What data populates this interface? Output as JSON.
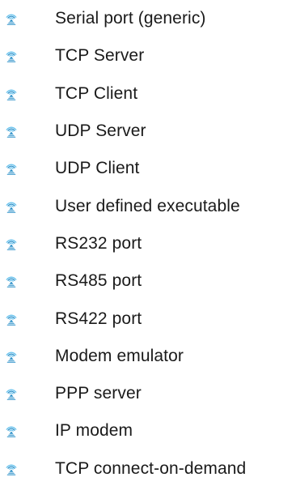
{
  "connection_types": {
    "icon": "signal-tower-icon",
    "icon_color": "#2a8fc8",
    "icon_accent": "#6cc4ee",
    "items": [
      {
        "label": "Serial port (generic)"
      },
      {
        "label": "TCP Server"
      },
      {
        "label": "TCP Client"
      },
      {
        "label": "UDP Server"
      },
      {
        "label": "UDP Client"
      },
      {
        "label": "User defined executable"
      },
      {
        "label": "RS232 port"
      },
      {
        "label": "RS485 port"
      },
      {
        "label": "RS422 port"
      },
      {
        "label": "Modem emulator"
      },
      {
        "label": "PPP server"
      },
      {
        "label": "IP modem"
      },
      {
        "label": "TCP connect-on-demand"
      }
    ]
  }
}
